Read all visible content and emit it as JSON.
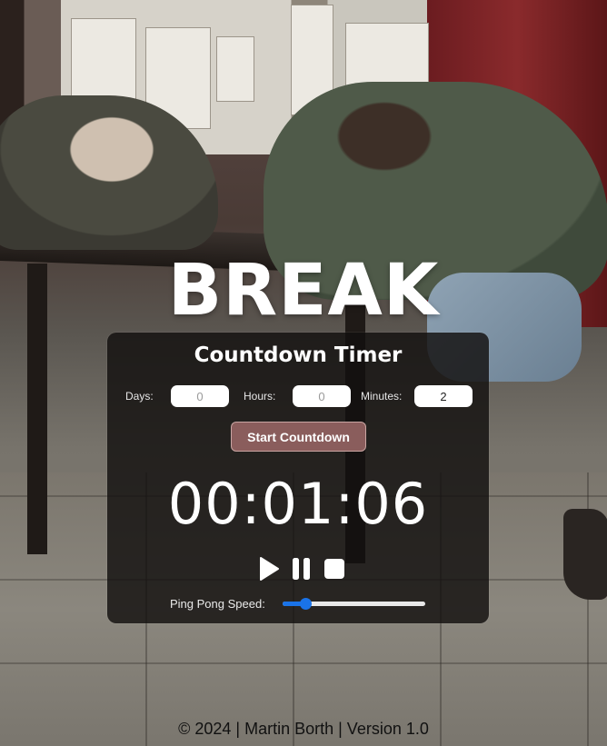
{
  "header": {
    "title": "BREAK"
  },
  "timer": {
    "heading": "Countdown Timer",
    "fields": {
      "days": {
        "label": "Days:",
        "value": "",
        "placeholder": "0"
      },
      "hours": {
        "label": "Hours:",
        "value": "",
        "placeholder": "0"
      },
      "minutes": {
        "label": "Minutes:",
        "value": "2",
        "placeholder": "0"
      }
    },
    "start_label": "Start Countdown",
    "display": "00:01:06",
    "controls": {
      "play_icon": "play-icon",
      "pause_icon": "pause-icon",
      "stop_icon": "stop-icon"
    },
    "speed": {
      "label": "Ping Pong Speed:",
      "fraction": 0.12
    }
  },
  "footer": {
    "text": "© 2024 | Martin Borth | Version 1.0"
  },
  "colors": {
    "accent": "#1a73e8",
    "start_button": "#8a5d5c",
    "panel": "#12100f"
  }
}
